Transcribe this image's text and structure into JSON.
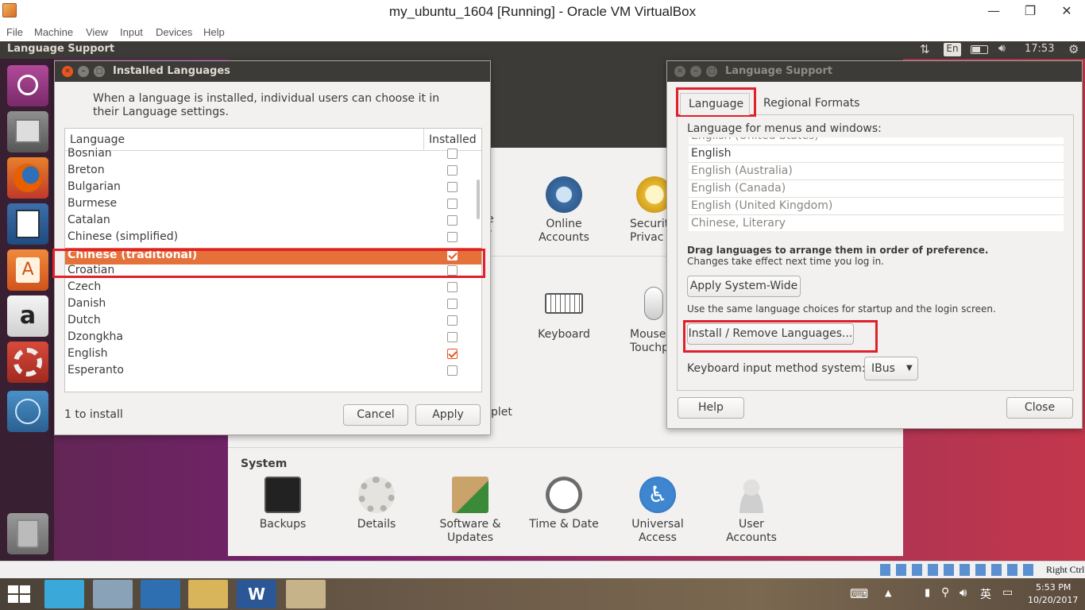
{
  "vbox": {
    "title": "my_ubuntu_1604 [Running] - Oracle VM VirtualBox",
    "menu": [
      "File",
      "Machine",
      "View",
      "Input",
      "Devices",
      "Help"
    ],
    "controls": {
      "minimize": "—",
      "restore": "❐",
      "close": "✕"
    },
    "host_key": "Right Ctrl"
  },
  "ubuntu_topbar": {
    "app_title": "Language Support",
    "keyboard_indicator": "En",
    "clock": "17:53"
  },
  "settings_bg": {
    "row1": [
      "Online\nAccounts",
      "Securit\nPrivac"
    ],
    "partial_left1": "e",
    "partial_left1b": "r",
    "row2": [
      "Keyboard",
      "Mouse\nTouchp"
    ],
    "partial_row3": "plet",
    "section_system": "System",
    "system_items": [
      "Backups",
      "Details",
      "Software &\nUpdates",
      "Time & Date",
      "Universal\nAccess",
      "User\nAccounts"
    ]
  },
  "installed_languages": {
    "title": "Installed Languages",
    "description": "When a language is installed, individual users can choose it in their Language settings.",
    "col_language": "Language",
    "col_installed": "Installed",
    "rows": [
      {
        "name": "Bosnian",
        "installed": false
      },
      {
        "name": "Breton",
        "installed": false
      },
      {
        "name": "Bulgarian",
        "installed": false
      },
      {
        "name": "Burmese",
        "installed": false
      },
      {
        "name": "Catalan",
        "installed": false
      },
      {
        "name": "Chinese (simplified)",
        "installed": false
      },
      {
        "name": "Chinese (traditional)",
        "installed": true,
        "selected": true
      },
      {
        "name": "Croatian",
        "installed": false
      },
      {
        "name": "Czech",
        "installed": false
      },
      {
        "name": "Danish",
        "installed": false
      },
      {
        "name": "Dutch",
        "installed": false
      },
      {
        "name": "Dzongkha",
        "installed": false
      },
      {
        "name": "English",
        "installed": true
      },
      {
        "name": "Esperanto",
        "installed": false
      }
    ],
    "status": "1 to install",
    "cancel": "Cancel",
    "apply": "Apply"
  },
  "language_support": {
    "title": "Language Support",
    "tab_language": "Language",
    "tab_regional": "Regional Formats",
    "menus_label": "Language for menus and windows:",
    "pref_list": [
      "English (United States)",
      "English",
      "English (Australia)",
      "English (Canada)",
      "English (United Kingdom)",
      "Chinese, Literary"
    ],
    "drag_hint": "Drag languages to arrange them in order of preference.",
    "drag_hint2": "Changes take effect next time you log in.",
    "apply_system_wide": "Apply System-Wide",
    "system_wide_hint": "Use the same language choices for startup and the login screen.",
    "install_remove": "Install / Remove Languages...",
    "kb_label": "Keyboard input method system:",
    "kb_value": "IBus",
    "help": "Help",
    "close": "Close"
  },
  "windows_taskbar": {
    "time": "5:53 PM",
    "date": "10/20/2017",
    "ime": "英"
  },
  "colors": {
    "accent": "#e95420",
    "highlight_box": "#e0202c",
    "titlebar": "#3c3b37"
  }
}
